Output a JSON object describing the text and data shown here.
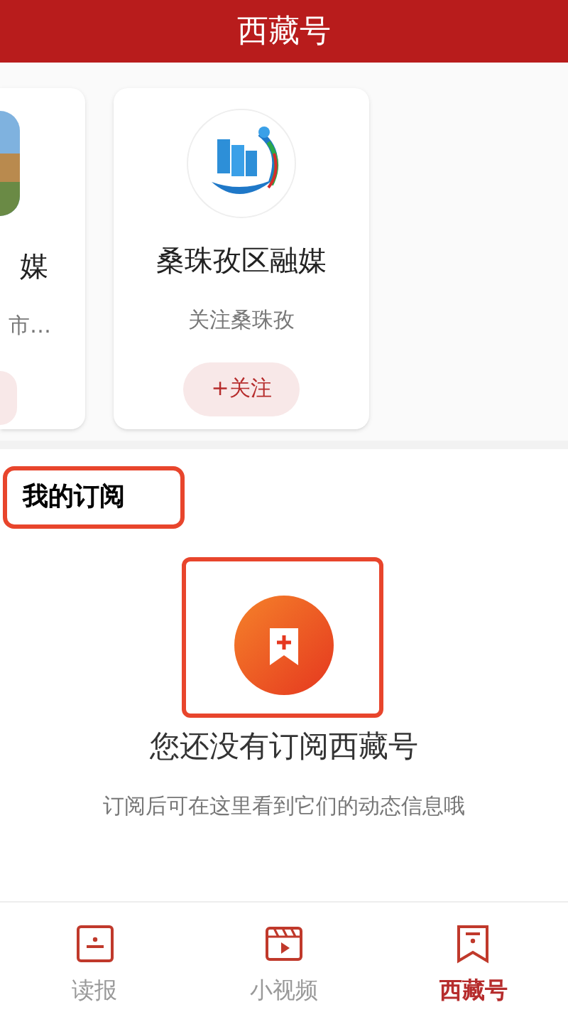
{
  "header": {
    "title": "西藏号"
  },
  "cards": [
    {
      "name": "媒",
      "subtitle": "市…",
      "partial": true
    },
    {
      "name": "桑珠孜区融媒",
      "subtitle": "关注桑珠孜",
      "button": "+关注",
      "partial": false
    }
  ],
  "subscriptions": {
    "title": "我的订阅",
    "empty_title": "您还没有订阅西藏号",
    "empty_text": "订阅后可在这里看到它们的动态信息哦"
  },
  "tabs": [
    {
      "label": "读报",
      "kind": "paper",
      "selected": false
    },
    {
      "label": "小视频",
      "kind": "video",
      "selected": false
    },
    {
      "label": "西藏号",
      "kind": "bookmark",
      "selected": true
    }
  ]
}
